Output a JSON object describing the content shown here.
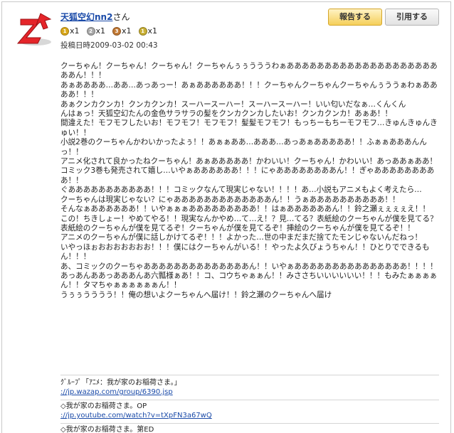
{
  "user": {
    "name": "天狐空幻nn2",
    "suffix": "さん"
  },
  "badges": [
    {
      "icon": "gold-medal-icon",
      "glyph": "1",
      "count": "x1"
    },
    {
      "icon": "silver-medal-icon",
      "glyph": "2",
      "count": "x1"
    },
    {
      "icon": "bronze-medal-icon",
      "glyph": "3",
      "count": "x1"
    },
    {
      "icon": "other-medal-icon",
      "glyph": "1",
      "count": "x1"
    }
  ],
  "post": {
    "date": "投稿日時2009-03-02 00:43",
    "body": "クーちゃん！クーちゃん！クーちゃん！クーちゃんぅぅうううわぁああああああああああああああああああああああん！！！\nあぁああああ…ああ…あっあっー！あぁああああああ！！！クーちゃんクーちゃんクーちゃんぅううぁわぁああああ！！！\nあぁクンカクンカ！クンカクンカ！スーハースーハー！スーハースーハー！いい匂いだなぁ…くんくん\nんはぁっ！天狐空幻たんの金色サラサラの髪をクンカクンカしたいお！クンカクンカ！あぁあ！！\n間違えた！モフモフしたいお！モフモフ！モフモフ！髪髪モフモフ！もっちーもちーモフモフ…きゅんきゅんきゅい！！\n小説2巻のクーちゃんかわいかったよぅ！！あぁぁああ…あああ…あっあぁあああああ！！ふぁぁあああんんっ！！\nアニメ化されて良かったねクーちゃん！あぁあああああ！かわいい！クーちゃん！かわいい！あっああぁああ！\nコミック3巻も発売されて嬉し…いやぁああああああ！！！にゃああああああああん！！ぎゃあああああああああ！！\nぐあああああああああああ！！！コミックなんて現実じゃない！！！！あ…小説もアニメもよく考えたら…\nクーちゃんは現実じゃない？にゃあああああああああああああん！！うぁああああああああああ！！\nそんなぁああああああ！！いやぁぁぁあああああああああ！！はぁああああああん！！鈴之瀬ぇぇぇぇえ！！\nこの！ちきしょー！やめてやる！！現実なんかやめ…て…え！？見…てる？表紙絵のクーちゃんが僕を見てる？\n表紙絵のクーちゃんが僕を見てるぞ！クーちゃんが僕を見てるぞ！挿絵のクーちゃんが僕を見てるぞ！！\nアニメのクーちゃんが僕に話しかけてるぞ！！！よかった…世の中まだまだ捨てたモンじゃないんだねっ！\nいやっほぉおおおおおおお！！！僕にはクーちゃんがいる！！やったよ久びょうちゃん！！ひとりでできるもん！！！\nあ、コミックのクーちゃああああああああああああああん！！いやぁあああああああああああああああ！！！！\nあっあんああっあああんあ六瓢様ぁあ！！コ、コウちゃぁぁん！！みささちいいいいいい！！！もみたぁぁぁぁん！！タマちゃぁぁぁぁぁぁん！！\nうぅぅうううう！！俺の想いよクーちゃんへ届け！！鈴之瀬のクーちゃんへ届け"
  },
  "buttons": {
    "report": "報告する",
    "quote": "引用する"
  },
  "links": {
    "group_label": "ｸﾞﾙｰﾌﾟ「ｱﾆﾒ：我が家のお稲荷さま。」",
    "group_url": "://jp.wazap.com/group/6390.jsp",
    "op_label": "◇我が家のお稲荷さま。OP",
    "op_url": "://jp.youtube.com/watch?v=tXpFN3a67wQ",
    "ed_label": "◇我が家のお稲荷さま。第ED"
  }
}
